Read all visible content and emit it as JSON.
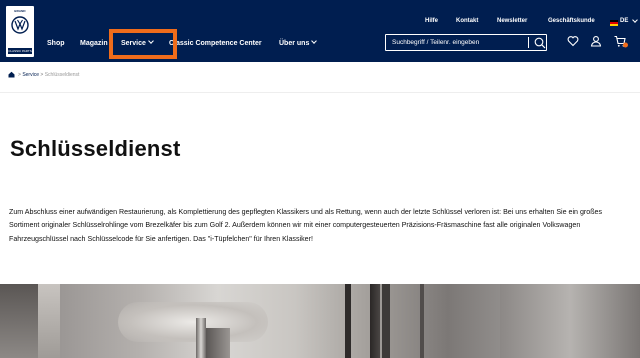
{
  "header": {
    "logo": {
      "top_text": "BRAND",
      "bottom_text": "CLASSIC PARTS"
    },
    "top_links": [
      "Hilfe",
      "Kontakt",
      "Newsletter",
      "Geschäftskunde"
    ],
    "language": "DE",
    "nav": [
      {
        "label": "Shop",
        "dropdown": false
      },
      {
        "label": "Magazin",
        "dropdown": false
      },
      {
        "label": "Service",
        "dropdown": true
      },
      {
        "label": "Classic Competence Center",
        "dropdown": false
      },
      {
        "label": "Über uns",
        "dropdown": true
      }
    ],
    "search": {
      "placeholder": "Suchbegriff / Teilenr. eingeben"
    },
    "icons": [
      "search-icon",
      "heart-icon",
      "user-icon",
      "cart-icon"
    ],
    "colors": {
      "background": "#001e50",
      "highlight": "#ef6c1b",
      "cart_badge": "#ef6c1b"
    }
  },
  "breadcrumb": {
    "items": [
      "Service",
      "Schlüsseldienst"
    ]
  },
  "main": {
    "title": "Schlüsseldienst",
    "body": "Zum Abschluss einer aufwändigen Restaurierung, als Komplettierung des gepflegten Klassikers und als Rettung, wenn auch der letzte Schlüssel verloren ist: Bei uns erhalten Sie ein großes Sortiment originaler Schlüsselrohlinge vom Brezelkäfer bis zum Golf 2. Außerdem können wir mit einer computergesteuerten Präzisions-Fräsmaschine fast alle originalen Volkswagen Fahrzeugschlüssel nach Schlüsselcode für Sie anfertigen. Das \"i-Tüpfelchen\" für Ihren Klassiker!"
  }
}
